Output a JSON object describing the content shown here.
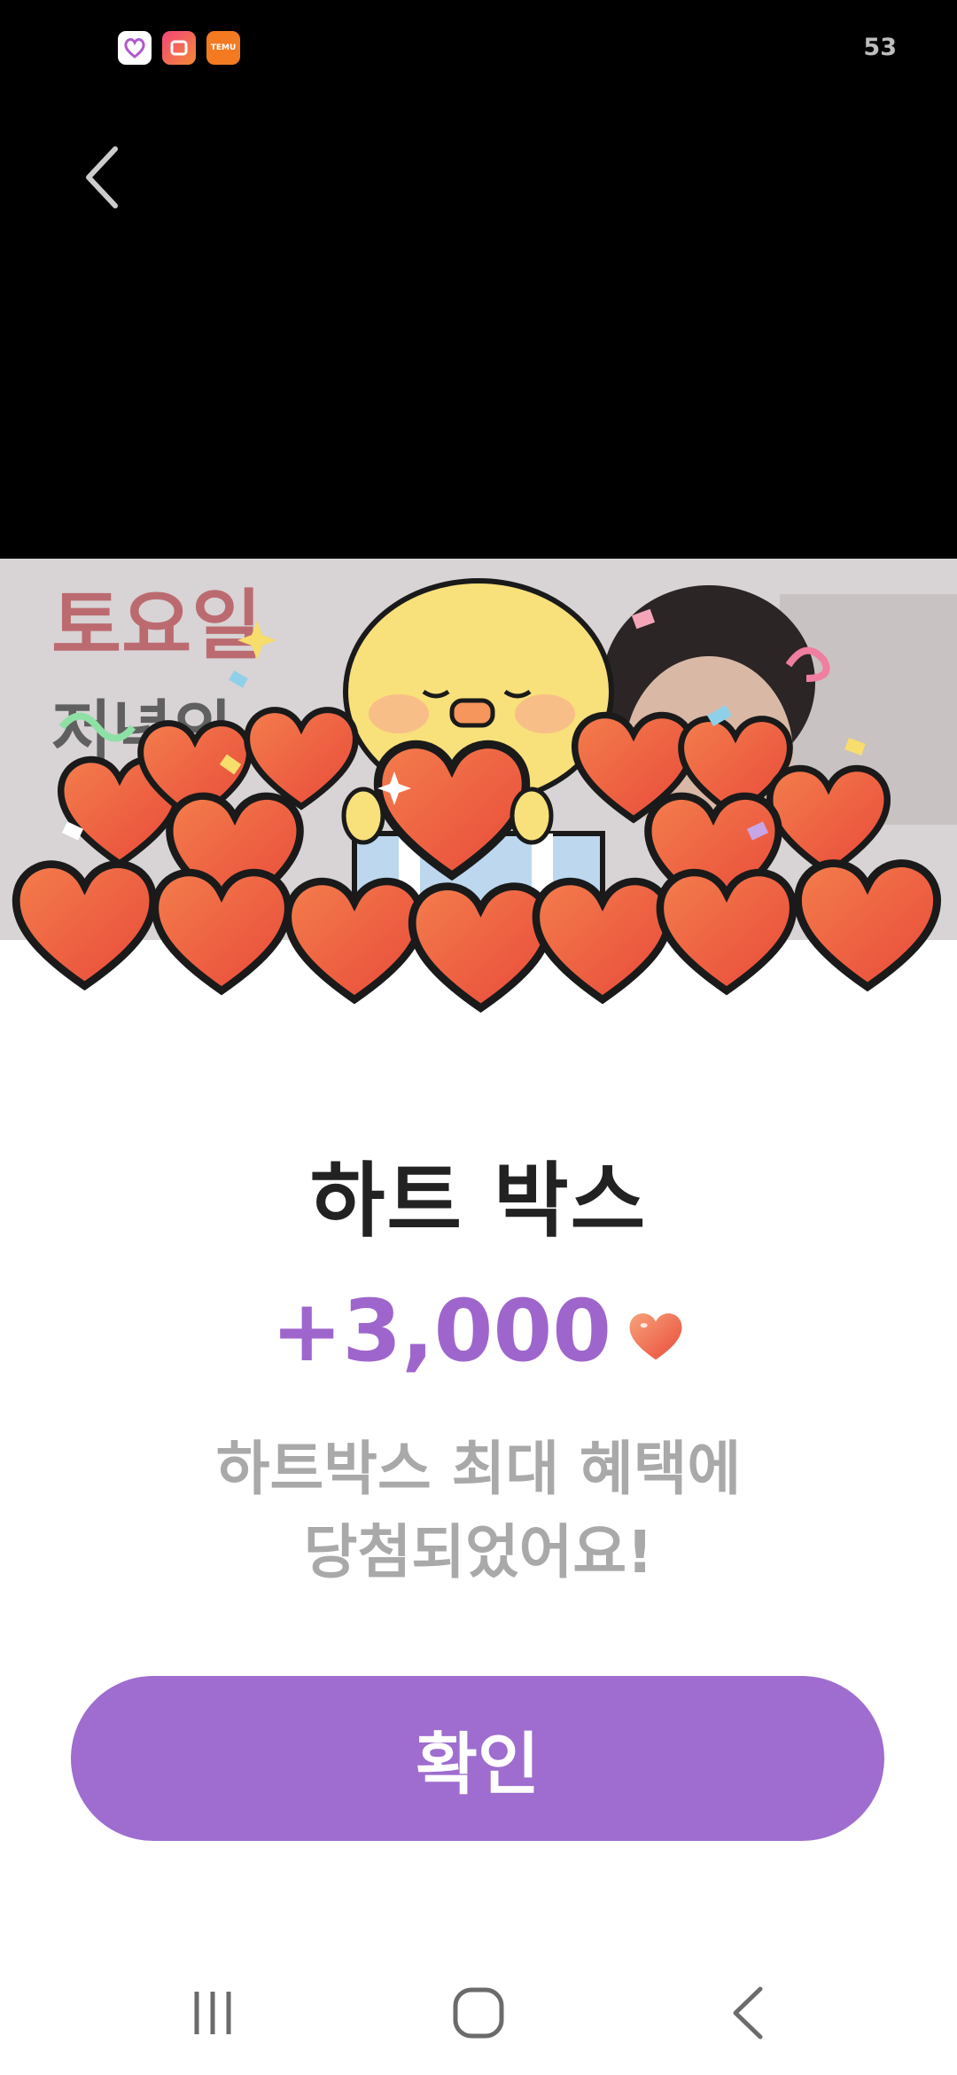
{
  "status_bar": {
    "time": "53",
    "app_icons": [
      "heart-app-icon",
      "gradient-app-icon",
      "temu-app-icon"
    ],
    "temu_label": "TEMU"
  },
  "banner": {
    "background_text": "토요일",
    "background_text_2": "저녁의"
  },
  "reward": {
    "title": "하트 박스",
    "amount": "+3,000",
    "message_line1": "하트박스 최대 혜택에",
    "message_line2": "당첨되었어요!"
  },
  "actions": {
    "confirm_label": "확인"
  },
  "colors": {
    "accent": "#9e6dcf",
    "amount": "#9e66cc",
    "heart": "#ef5a3c"
  }
}
